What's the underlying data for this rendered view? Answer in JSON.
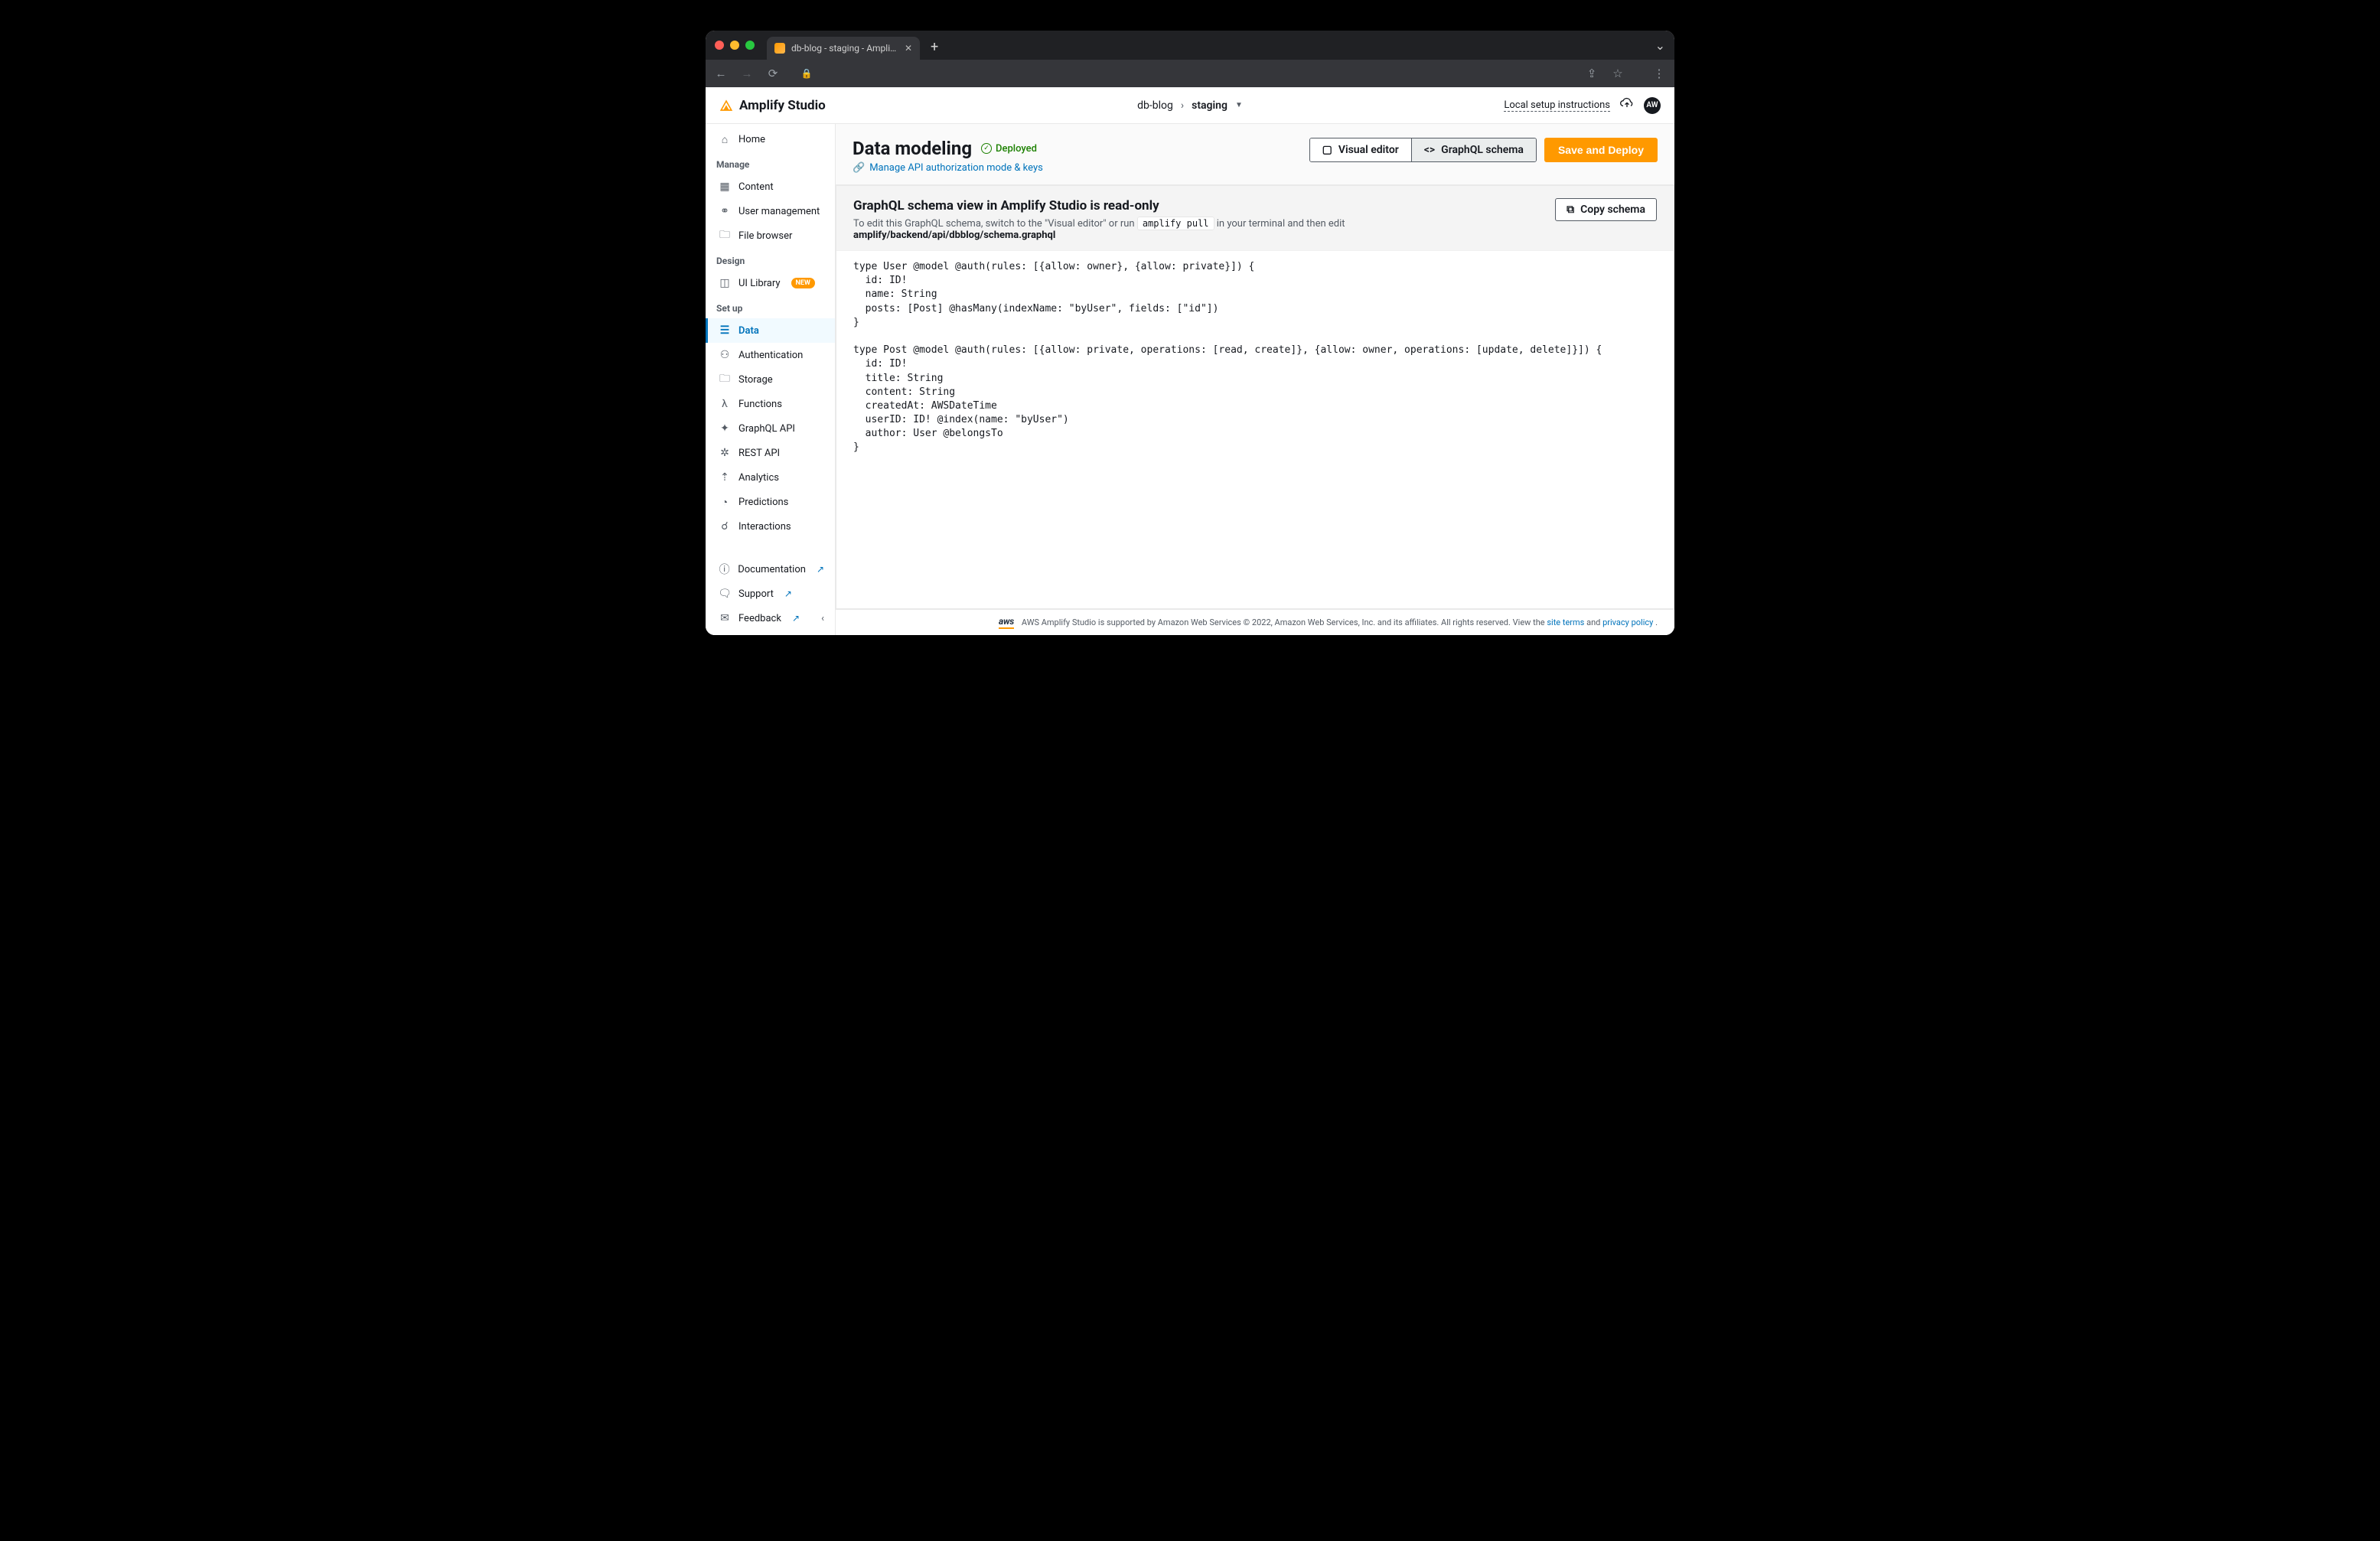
{
  "browser": {
    "tab_title": "db-blog - staging - Amplify St…",
    "traffic": [
      "#ff5f57",
      "#febc2e",
      "#28c840"
    ]
  },
  "header": {
    "app_title": "Amplify Studio",
    "breadcrumb": {
      "app": "db-blog",
      "env": "staging"
    },
    "setup_link": "Local setup instructions",
    "avatar": "AW"
  },
  "sidebar": {
    "home": "Home",
    "sections": {
      "manage": {
        "label": "Manage",
        "items": [
          {
            "key": "content",
            "label": "Content"
          },
          {
            "key": "user-mgmt",
            "label": "User management"
          },
          {
            "key": "file-browser",
            "label": "File browser"
          }
        ]
      },
      "design": {
        "label": "Design",
        "items": [
          {
            "key": "ui-library",
            "label": "UI Library",
            "badge": "NEW"
          }
        ]
      },
      "setup": {
        "label": "Set up",
        "items": [
          {
            "key": "data",
            "label": "Data",
            "active": true
          },
          {
            "key": "authentication",
            "label": "Authentication"
          },
          {
            "key": "storage",
            "label": "Storage"
          },
          {
            "key": "functions",
            "label": "Functions"
          },
          {
            "key": "graphql-api",
            "label": "GraphQL API"
          },
          {
            "key": "rest-api",
            "label": "REST API"
          },
          {
            "key": "analytics",
            "label": "Analytics"
          },
          {
            "key": "predictions",
            "label": "Predictions"
          },
          {
            "key": "interactions",
            "label": "Interactions"
          }
        ]
      }
    },
    "support": {
      "documentation": "Documentation",
      "support": "Support",
      "feedback": "Feedback"
    }
  },
  "page": {
    "title": "Data modeling",
    "status_label": "Deployed",
    "manage_link": "Manage API authorization mode & keys",
    "tabs": {
      "visual": "Visual editor",
      "graphql": "GraphQL schema"
    },
    "save_btn": "Save and Deploy"
  },
  "panel": {
    "heading": "GraphQL schema view in Amplify Studio is read-only",
    "desc_before": "To edit this GraphQL schema, switch to the \"Visual editor\" or run ",
    "desc_cmd": "amplify pull",
    "desc_mid": " in your terminal and then edit ",
    "desc_path": "amplify/backend/api/dbblog/schema.graphql",
    "copy_btn": "Copy schema"
  },
  "code": "type User @model @auth(rules: [{allow: owner}, {allow: private}]) {\n  id: ID!\n  name: String\n  posts: [Post] @hasMany(indexName: \"byUser\", fields: [\"id\"])\n}\n\ntype Post @model @auth(rules: [{allow: private, operations: [read, create]}, {allow: owner, operations: [update, delete]}]) {\n  id: ID!\n  title: String\n  content: String\n  createdAt: AWSDateTime\n  userID: ID! @index(name: \"byUser\")\n  author: User @belongsTo\n}",
  "footer": {
    "text_a": "AWS Amplify Studio is supported by Amazon Web Services © 2022, Amazon Web Services, Inc. and its affiliates. All rights reserved. View the ",
    "link1": "site terms",
    "text_b": " and ",
    "link2": "privacy policy",
    "text_c": " ."
  }
}
